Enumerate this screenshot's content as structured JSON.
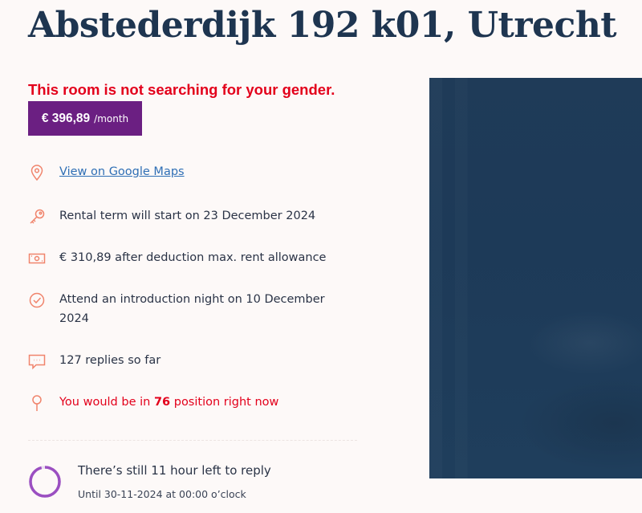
{
  "listing": {
    "title": "Abstederdijk 192 k01, Utrecht",
    "gender_warning": "This room is not searching for your gender.",
    "price": {
      "amount": "€ 396,89",
      "unit": "/month"
    }
  },
  "details": {
    "maps_link": "View on Google Maps",
    "rental_term": "Rental term will start on 23 December 2024",
    "rent_allowance": "€ 310,89 after deduction max. rent allowance",
    "intro_night": "Attend an introduction night on 10 December 2024",
    "replies": "127 replies so far",
    "position": {
      "prefix": "You would be in ",
      "rank": "76",
      "suffix": " position right now"
    }
  },
  "deadline": {
    "title": "There’s still 11 hour left to reply",
    "until": "Until 30-11-2024 at 00:00 o’clock",
    "progress_fraction": 0.96
  },
  "colors": {
    "title": "#1e3550",
    "warning": "#e3001b",
    "price_bg": "#6b1f82",
    "icon": "#f0846c",
    "link": "#2f6fb5",
    "progress": "#9b4fc1",
    "photo": "#1f3b58"
  },
  "icons": {
    "maps": "map-pin-icon",
    "rental_term": "key-icon",
    "rent_allowance": "banknote-icon",
    "intro_night": "check-circle-icon",
    "replies": "chat-bubble-icon",
    "position": "pin-icon"
  }
}
